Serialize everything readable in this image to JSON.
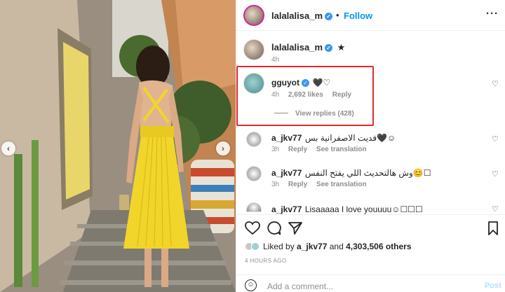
{
  "header": {
    "username": "lalalalisa_m",
    "follow_label": "Follow",
    "separator": "•",
    "more_icon": "more-dots-icon"
  },
  "caption": {
    "username": "lalalalisa_m",
    "text": "★",
    "time": "4h"
  },
  "comments": [
    {
      "username": "gguyot",
      "text": "🖤♡",
      "time": "4h",
      "likes": "2,692 likes",
      "reply": "Reply",
      "view_replies": "View replies (428)"
    },
    {
      "username": "a_jkv77",
      "text": "فديت الاصفرانية بس🖤☺",
      "time": "3h",
      "reply": "Reply",
      "translation": "See translation"
    },
    {
      "username": "a_jkv77",
      "text": "وش هالتحديث اللي يفتح النفس😊☐",
      "time": "3h",
      "reply": "Reply",
      "translation": "See translation"
    },
    {
      "username": "a_jkv77",
      "text": "Lisaaaaa I love youuuu☺☐☐☐",
      "time": "",
      "reply": "",
      "translation": ""
    }
  ],
  "footer": {
    "liked_by_prefix": "Liked by ",
    "liked_by_user": "a_jkv77",
    "liked_by_mid": " and ",
    "liked_by_count": "4,303,506 others",
    "time_ago": "4 HOURS AGO",
    "add_comment_placeholder": "Add a comment...",
    "post_label": "Post"
  },
  "colors": {
    "accent": "#0095f6",
    "highlight": "#e8272c",
    "dress": "#f2d52a"
  },
  "icons": [
    "heart-icon",
    "comment-icon",
    "share-icon",
    "bookmark-icon",
    "emoji-icon",
    "chevron-left-icon",
    "chevron-right-icon"
  ]
}
